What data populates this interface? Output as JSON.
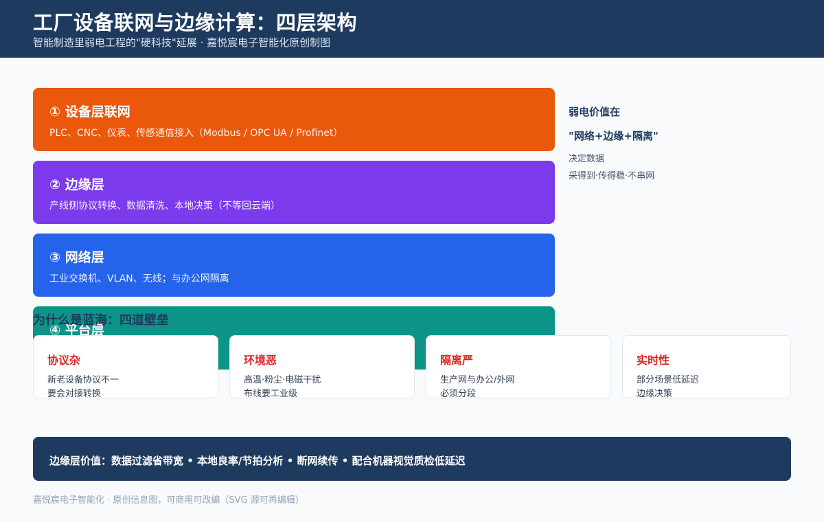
{
  "header": {
    "title": "工厂设备联网与边缘计算：四层架构",
    "subtitle": "智能制造里弱电工程的\"硬科技\"延展 · 嘉悦宸电子智能化原创制图"
  },
  "layers": [
    {
      "title": "① 设备层联网",
      "desc": "PLC、CNC、仪表、传感通信接入（Modbus / OPC UA / Profinet）",
      "color": "#ea580c"
    },
    {
      "title": "② 边缘层",
      "desc": "产线侧协议转换、数据清洗、本地决策（不等回云端）",
      "color": "#7c3aed"
    },
    {
      "title": "③ 网络层",
      "desc": "工业交换机、VLAN、无线；与办公网隔离",
      "color": "#2563eb"
    },
    {
      "title": "④ 平台层",
      "desc": "",
      "color": "#0d9488"
    }
  ],
  "side_note": {
    "line1": "弱电价值在",
    "line2": "\"网络+边缘+隔离\"",
    "line3": "决定数据",
    "line4": "采得到·传得稳·不串网"
  },
  "barriers": {
    "title": "为什么是蓝海：四道壁垒",
    "cards": [
      {
        "title": "协议杂",
        "line1": "新老设备协议不一",
        "line2": "要会对接转换"
      },
      {
        "title": "环境恶",
        "line1": "高温·粉尘·电磁干扰",
        "line2": "布线要工业级"
      },
      {
        "title": "隔离严",
        "line1": "生产网与办公/外网",
        "line2": "必须分段"
      },
      {
        "title": "实时性",
        "line1": "部分场景低延迟",
        "line2": "边缘决策"
      }
    ]
  },
  "value_bar": {
    "text": "边缘层价值：数据过滤省带宽 • 本地良率/节拍分析 • 断网续传 • 配合机器视觉质检低延迟"
  },
  "footer": {
    "text": "嘉悦宸电子智能化 · 原创信息图，可商用可改编（SVG 源可再编辑）"
  }
}
